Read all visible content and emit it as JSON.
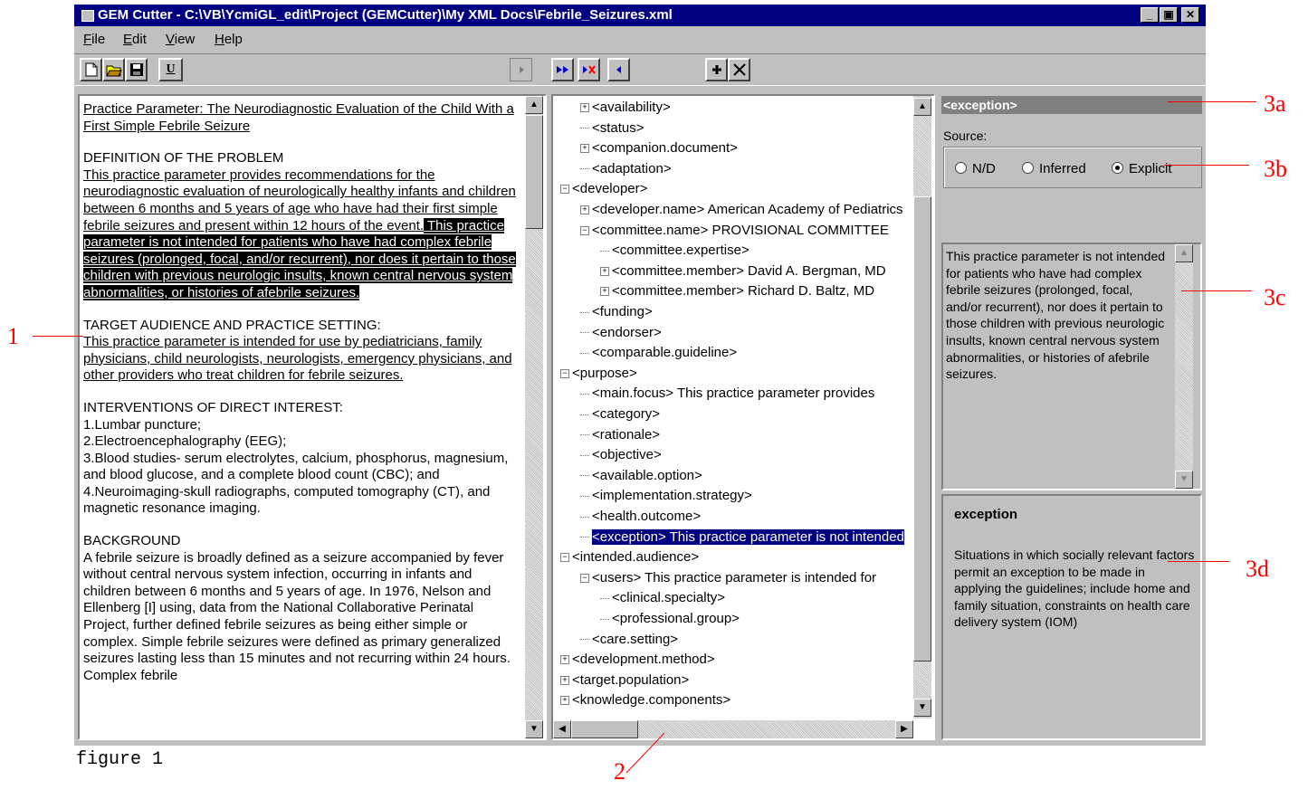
{
  "window": {
    "title": "GEM Cutter - C:\\VB\\YcmiGL_edit\\Project (GEMCutter)\\My XML Docs\\Febrile_Seizures.xml",
    "controls": [
      "_",
      "▣",
      "✕"
    ]
  },
  "menu": [
    {
      "key": "F",
      "rest": "ile"
    },
    {
      "key": "E",
      "rest": "dit"
    },
    {
      "key": "V",
      "rest": "iew"
    },
    {
      "key": "H",
      "rest": "elp"
    }
  ],
  "toolbar": {
    "underline_label": "U",
    "icons": [
      "new-document-icon",
      "open-folder-icon",
      "save-disk-icon",
      "underline-icon",
      "play-icon",
      "fast-forward-icon",
      "clear-forward-icon",
      "step-back-icon",
      "add-icon",
      "delete-icon"
    ]
  },
  "document": {
    "heading": "Practice Parameter: The Neurodiagnostic Evaluation of the Child With a First Simple Febrile Seizure",
    "definition_title": "DEFINITION OF THE PROBLEM",
    "definition_text": "This practice parameter provides recommendations for the neurodiagnostic evaluation of neurologically healthy infants and children between 6 months and 5 years of age who have had their first simple febrile seizures and present within 12 hours of the event.",
    "definition_selected": " This practice parameter is not intended for patients who have had complex febrile seizures (prolonged, focal, and/or recurrent), nor does it pertain to those children with previous neurologic insults, known central nervous system abnormalities, or histories of afebrile seizures. ",
    "audience_title": "TARGET AUDIENCE AND PRACTICE SETTING:",
    "audience_text": "This practice parameter is intended for use by pediatricians, family physicians, child neurologists, neurologists, emergency physicians, and other providers who treat children for febrile seizures.",
    "interventions_title": "INTERVENTIONS OF DIRECT INTEREST:",
    "interventions": [
      "1.Lumbar puncture;",
      "2.Electroencephalography (EEG);",
      "3.Blood studies- serum electrolytes, calcium, phosphorus, magnesium, and blood glucose, and a complete blood count (CBC); and",
      "4.Neuroimaging-skull radiographs, computed tomography (CT), and magnetic resonance imaging."
    ],
    "background_title": "BACKGROUND",
    "background_text": "A febrile seizure is broadly defined as a seizure accompanied by fever without central nervous system infection, occurring in infants and children between 6 months and 5 years of age. In 1976, Nelson and Ellenberg [I] using, data from the National Collaborative Perinatal Project, further defined febrile seizures as being either simple or complex.  Simple febrile seizures were defined as primary generalized seizures lasting less than 15 minutes and not recurring within 24 hours.  Complex febrile"
  },
  "tree": [
    {
      "indent": 1,
      "node": "plus",
      "text": "<availability>"
    },
    {
      "indent": 1,
      "node": "leaf",
      "text": "<status>"
    },
    {
      "indent": 1,
      "node": "plus",
      "text": "<companion.document>"
    },
    {
      "indent": 1,
      "node": "leaf",
      "text": "<adaptation>"
    },
    {
      "indent": 0,
      "node": "minus",
      "text": "<developer>"
    },
    {
      "indent": 1,
      "node": "plus",
      "text": "<developer.name> American Academy of Pediatrics"
    },
    {
      "indent": 1,
      "node": "minus",
      "text": "<committee.name> PROVISIONAL COMMITTEE"
    },
    {
      "indent": 2,
      "node": "leaf",
      "text": "<committee.expertise>"
    },
    {
      "indent": 2,
      "node": "plus",
      "text": "<committee.member> David A. Bergman, MD"
    },
    {
      "indent": 2,
      "node": "plus",
      "text": "<committee.member> Richard D. Baltz, MD"
    },
    {
      "indent": 1,
      "node": "leaf",
      "text": "<funding>"
    },
    {
      "indent": 1,
      "node": "leaf",
      "text": "<endorser>"
    },
    {
      "indent": 1,
      "node": "leaf",
      "text": "<comparable.guideline>"
    },
    {
      "indent": 0,
      "node": "minus",
      "text": "<purpose>"
    },
    {
      "indent": 1,
      "node": "leaf",
      "text": "<main.focus> This practice parameter provides"
    },
    {
      "indent": 1,
      "node": "leaf",
      "text": "<category>"
    },
    {
      "indent": 1,
      "node": "leaf",
      "text": "<rationale>"
    },
    {
      "indent": 1,
      "node": "leaf",
      "text": "<objective>"
    },
    {
      "indent": 1,
      "node": "leaf",
      "text": "<available.option>"
    },
    {
      "indent": 1,
      "node": "leaf",
      "text": "<implementation.strategy>"
    },
    {
      "indent": 1,
      "node": "leaf",
      "text": "<health.outcome>"
    },
    {
      "indent": 1,
      "node": "leaf",
      "text": "<exception> This practice parameter is not intended",
      "selected": true
    },
    {
      "indent": 0,
      "node": "minus",
      "text": "<intended.audience>"
    },
    {
      "indent": 1,
      "node": "minus",
      "text": "<users> This practice parameter is intended for"
    },
    {
      "indent": 2,
      "node": "leaf",
      "text": "<clinical.specialty>"
    },
    {
      "indent": 2,
      "node": "leaf",
      "text": "<professional.group>"
    },
    {
      "indent": 1,
      "node": "leaf",
      "text": "<care.setting>"
    },
    {
      "indent": 0,
      "node": "plus",
      "text": "<development.method>"
    },
    {
      "indent": 0,
      "node": "plus",
      "text": "<target.population>"
    },
    {
      "indent": 0,
      "node": "plus",
      "text": "<knowledge.components>"
    }
  ],
  "inspector": {
    "header": "<exception>",
    "source_label": "Source:",
    "options": [
      "N/D",
      "Inferred",
      "Explicit"
    ],
    "selected_option": "Explicit",
    "content": "This practice parameter is not intended for patients who have had complex febrile seizures (prolonged, focal, and/or recurrent), nor does it pertain to those children with previous neurologic insults, known central nervous system abnormalities, or histories of afebrile seizures.",
    "definition_name": "exception",
    "definition": "Situations in which socially relevant factors permit an exception to be made in applying the guidelines; include home and family situation, constraints on health care delivery system (IOM)"
  },
  "annotations": {
    "a1": "1",
    "a2": "2",
    "a3a": "3a",
    "a3b": "3b",
    "a3c": "3c",
    "a3d": "3d",
    "caption": "figure 1",
    "color": "#ff0000"
  }
}
